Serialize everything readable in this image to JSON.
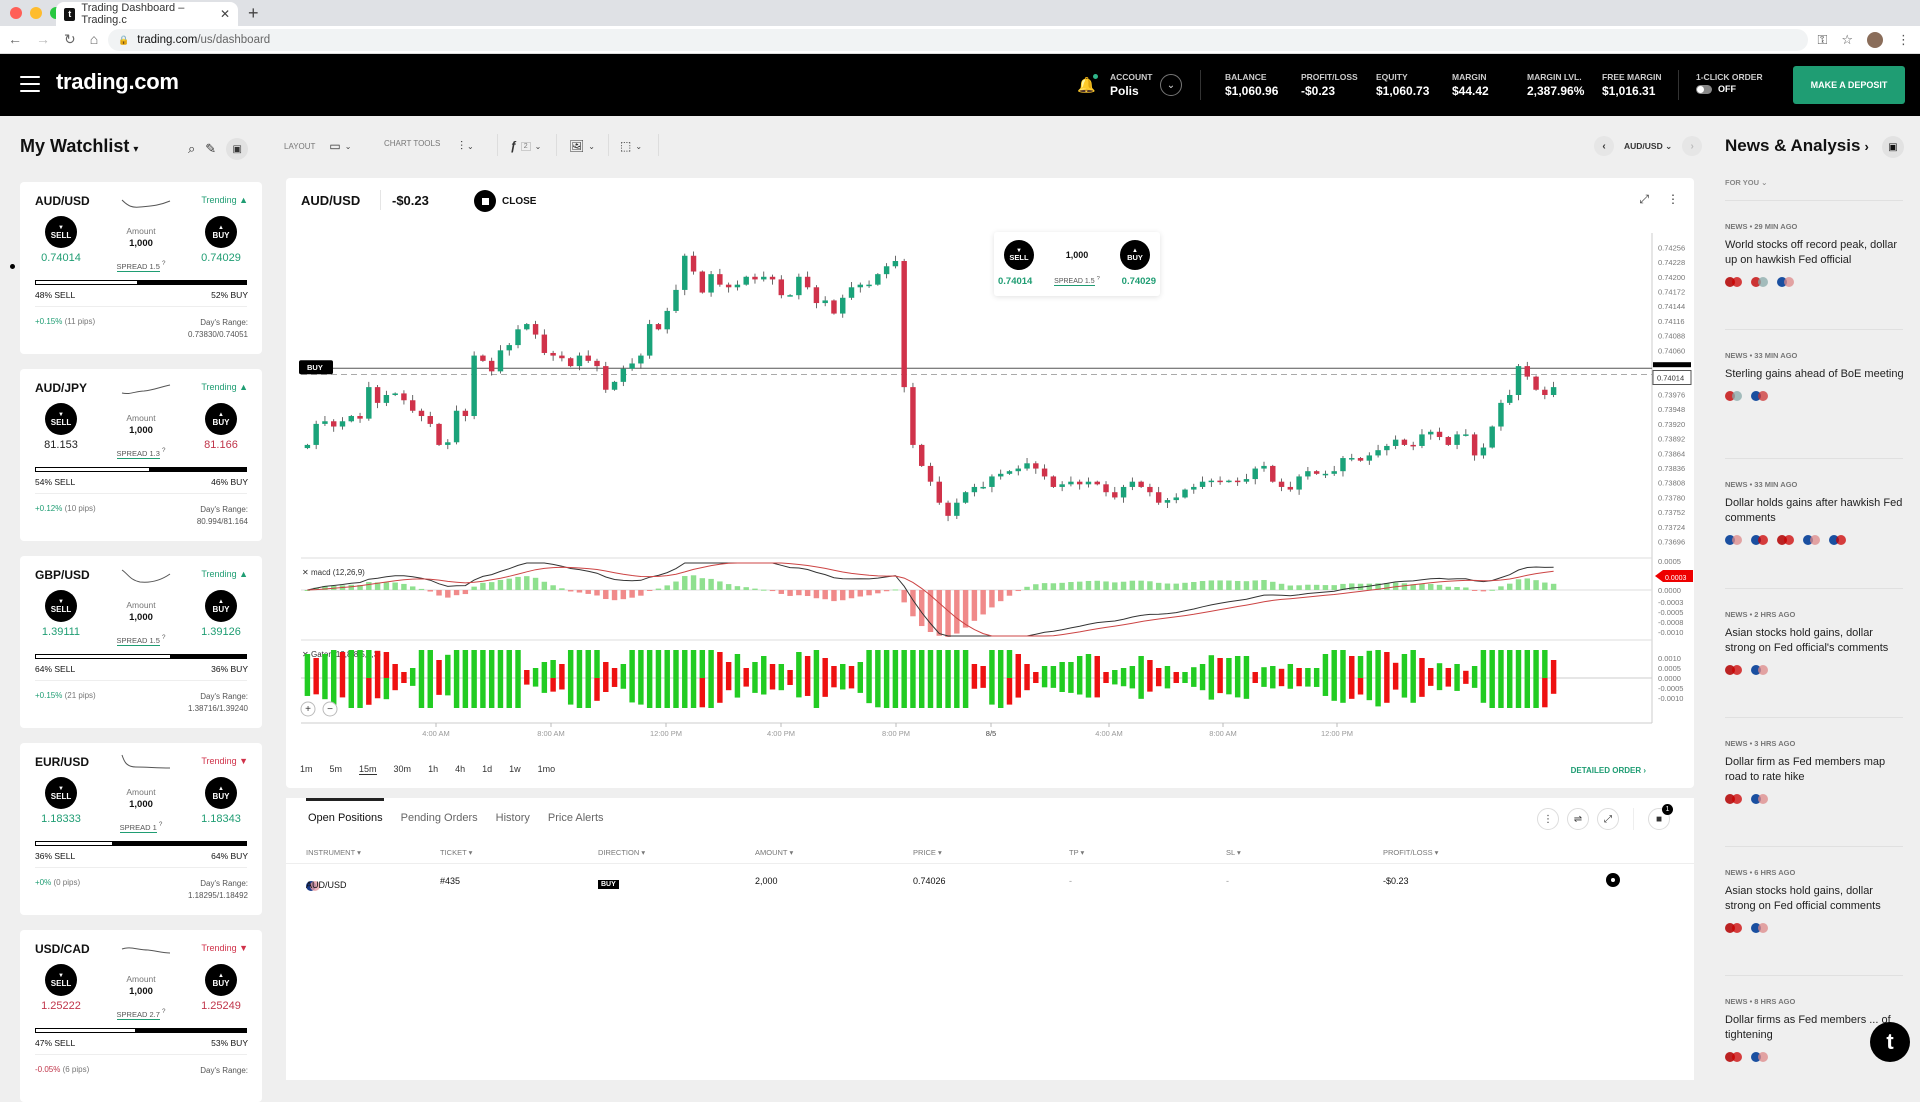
{
  "browser": {
    "tab_title": "Trading Dashboard – Trading.c",
    "url_host": "trading.com",
    "url_path": "/us/dashboard"
  },
  "header": {
    "logo": "trading.com",
    "account_label": "ACCOUNT",
    "account_value": "Polis",
    "stats": [
      {
        "label": "BALANCE",
        "value": "$1,060.96"
      },
      {
        "label": "PROFIT/LOSS",
        "value": "-$0.23"
      },
      {
        "label": "EQUITY",
        "value": "$1,060.73"
      },
      {
        "label": "MARGIN",
        "value": "$44.42"
      },
      {
        "label": "MARGIN LVL.",
        "value": "2,387.96%"
      },
      {
        "label": "FREE MARGIN",
        "value": "$1,016.31"
      }
    ],
    "one_click_label": "1-CLICK ORDER",
    "one_click_state": "OFF",
    "deposit_label": "MAKE A DEPOSIT"
  },
  "watchlist": {
    "title": "My Watchlist",
    "amount_label": "Amount",
    "sell_label": "SELL",
    "buy_label": "BUY",
    "days_range_label": "Day's Range:",
    "items": [
      {
        "symbol": "AUD/USD",
        "trend": "Trending ▲",
        "trend_dir": "up",
        "sell": "0.74014",
        "buy": "0.74029",
        "sell_color": "g",
        "buy_color": "g",
        "amount": "1,000",
        "spread": "SPREAD 1.5",
        "sell_pct": 48,
        "sell_text": "48% SELL",
        "buy_text": "52% BUY",
        "change_pct": "+0.15%",
        "change_color": "g",
        "change_pips": "(11 pips)",
        "range": "0.73830/0.74051"
      },
      {
        "symbol": "AUD/JPY",
        "trend": "Trending ▲",
        "trend_dir": "up",
        "sell": "81.153",
        "buy": "81.166",
        "sell_color": "k",
        "buy_color": "r",
        "amount": "1,000",
        "spread": "SPREAD 1.3",
        "sell_pct": 54,
        "sell_text": "54% SELL",
        "buy_text": "46% BUY",
        "change_pct": "+0.12%",
        "change_color": "g",
        "change_pips": "(10 pips)",
        "range": "80.994/81.164"
      },
      {
        "symbol": "GBP/USD",
        "trend": "Trending ▲",
        "trend_dir": "up",
        "sell": "1.39111",
        "buy": "1.39126",
        "sell_color": "g",
        "buy_color": "g",
        "amount": "1,000",
        "spread": "SPREAD 1.5",
        "sell_pct": 64,
        "sell_text": "64% SELL",
        "buy_text": "36% BUY",
        "change_pct": "+0.15%",
        "change_color": "g",
        "change_pips": "(21 pips)",
        "range": "1.38716/1.39240"
      },
      {
        "symbol": "EUR/USD",
        "trend": "Trending ▼",
        "trend_dir": "down",
        "sell": "1.18333",
        "buy": "1.18343",
        "sell_color": "g",
        "buy_color": "g",
        "amount": "1,000",
        "spread": "SPREAD 1",
        "sell_pct": 36,
        "sell_text": "36% SELL",
        "buy_text": "64% BUY",
        "change_pct": "+0%",
        "change_color": "g",
        "change_pips": "(0 pips)",
        "range": "1.18295/1.18492"
      },
      {
        "symbol": "USD/CAD",
        "trend": "Trending ▼",
        "trend_dir": "down",
        "sell": "1.25222",
        "buy": "1.25249",
        "sell_color": "r",
        "buy_color": "r",
        "amount": "1,000",
        "spread": "SPREAD 2.7",
        "sell_pct": 47,
        "sell_text": "47% SELL",
        "buy_text": "53% BUY",
        "change_pct": "-0.05%",
        "change_color": "r",
        "change_pips": "(6 pips)",
        "range": ""
      }
    ]
  },
  "toolbar": {
    "layout_label": "LAYOUT",
    "chart_tools_label": "CHART TOOLS",
    "indicator_count": "2",
    "pair_selector": "AUD/USD"
  },
  "chart_panel": {
    "symbol": "AUD/USD",
    "pl": "-$0.23",
    "close_label": "CLOSE",
    "quick_trade": {
      "sell_label": "SELL",
      "buy_label": "BUY",
      "amount": "1,000",
      "spread": "SPREAD 1.5",
      "sell_price": "0.74014",
      "buy_price": "0.74029"
    },
    "timeframes": [
      "1m",
      "5m",
      "15m",
      "30m",
      "1h",
      "4h",
      "1d",
      "1w",
      "1mo"
    ],
    "active_timeframe": "15m",
    "detailed_order": "DETAILED ORDER ›",
    "zoom_in": "+",
    "zoom_out": "−"
  },
  "chart_data": {
    "type": "candlestick",
    "title": "AUD/USD",
    "price_axis_ticks": [
      "0.74256",
      "0.74228",
      "0.74200",
      "0.74172",
      "0.74144",
      "0.74116",
      "0.74088",
      "0.74060",
      "0.73976",
      "0.73948",
      "0.73920",
      "0.73892",
      "0.73864",
      "0.73836",
      "0.73808",
      "0.73780",
      "0.73752",
      "0.73724",
      "0.73696"
    ],
    "ylim": [
      0.7368,
      0.7427
    ],
    "current_price_label": "0.74014",
    "buy_line_label": "BUY",
    "buy_line_price": 0.74026,
    "current_price": 0.74014,
    "time_axis_ticks": [
      "4:00 AM",
      "8:00 AM",
      "12:00 PM",
      "4:00 PM",
      "8:00 PM",
      "8/5",
      "4:00 AM",
      "8:00 AM",
      "12:00 PM"
    ],
    "candles_close": [
      0.7388,
      0.7392,
      0.73925,
      0.73915,
      0.73925,
      0.73935,
      0.7393,
      0.7399,
      0.7396,
      0.73975,
      0.73978,
      0.73965,
      0.73945,
      0.73935,
      0.7392,
      0.7388,
      0.73885,
      0.73945,
      0.73935,
      0.7405,
      0.7404,
      0.7402,
      0.7406,
      0.7407,
      0.741,
      0.7411,
      0.7409,
      0.74055,
      0.7405,
      0.74045,
      0.7403,
      0.7405,
      0.7404,
      0.7403,
      0.73985,
      0.74,
      0.74025,
      0.74035,
      0.7405,
      0.7411,
      0.741,
      0.74135,
      0.74175,
      0.7424,
      0.7421,
      0.7417,
      0.74205,
      0.74185,
      0.7418,
      0.74185,
      0.742,
      0.74195,
      0.742,
      0.74195,
      0.74165,
      0.74165,
      0.742,
      0.7418,
      0.7415,
      0.74155,
      0.7413,
      0.7416,
      0.7418,
      0.74185,
      0.74185,
      0.74205,
      0.7422,
      0.7423,
      0.7399,
      0.7388,
      0.7384,
      0.7381,
      0.7377,
      0.73745,
      0.7377,
      0.7379,
      0.738,
      0.738,
      0.7382,
      0.73825,
      0.7383,
      0.73835,
      0.73845,
      0.73835,
      0.7382,
      0.738,
      0.73805,
      0.7381,
      0.73805,
      0.7381,
      0.73805,
      0.7379,
      0.7378,
      0.738,
      0.7381,
      0.738,
      0.7379,
      0.7377,
      0.73775,
      0.7378,
      0.73795,
      0.738,
      0.7381,
      0.73812,
      0.7381,
      0.73812,
      0.7381,
      0.73815,
      0.73835,
      0.7384,
      0.7381,
      0.738,
      0.73795,
      0.7382,
      0.7383,
      0.73825,
      0.73825,
      0.7383,
      0.73855,
      0.73855,
      0.7385,
      0.7386,
      0.7387,
      0.73878,
      0.7389,
      0.7388,
      0.73878,
      0.739,
      0.73905,
      0.73895,
      0.7388,
      0.739,
      0.739,
      0.7386,
      0.73875,
      0.73915,
      0.7396,
      0.73975,
      0.7403,
      0.7401,
      0.73985,
      0.73975,
      0.7399
    ],
    "indicators": [
      {
        "name": "macd (12,26,9)",
        "axis_ticks": [
          "0.0005",
          "0.0000",
          "-0.0003",
          "-0.0005",
          "-0.0008",
          "-0.0010"
        ],
        "current_label": "0.0003"
      },
      {
        "name": "Gator (13,8,8,5,5,3)",
        "axis_ticks": [
          "0.0010",
          "0.0005",
          "0.0000",
          "-0.0005",
          "-0.0010"
        ]
      }
    ]
  },
  "positions": {
    "tabs": [
      "Open Positions",
      "Pending Orders",
      "History",
      "Price Alerts"
    ],
    "active_tab": "Open Positions",
    "badge_count": "1",
    "columns": [
      "INSTRUMENT ▾",
      "TICKET ▾",
      "DIRECTION ▾",
      "AMOUNT ▾",
      "PRICE ▾",
      "TP ▾",
      "SL ▾",
      "PROFIT/LOSS ▾"
    ],
    "rows": [
      {
        "instrument": "AUD/USD",
        "ticket": "#435",
        "direction": "BUY",
        "amount": "2,000",
        "price": "0.74026",
        "tp": "-",
        "sl": "-",
        "pl": "-$0.23"
      }
    ]
  },
  "news": {
    "title": "News & Analysis",
    "filter": "FOR YOU ⌄",
    "items": [
      {
        "meta": "NEWS • 29 MIN AGO",
        "headline": "World stocks off record peak, dollar up on hawkish Fed official",
        "flags": [
          [
            "#b22",
            "#c00"
          ],
          [
            "#c33",
            "#8aa"
          ],
          [
            "#1a4fa0",
            "#d88"
          ]
        ]
      },
      {
        "meta": "NEWS • 33 MIN AGO",
        "headline": "Sterling gains ahead of BoE meeting",
        "flags": [
          [
            "#c33",
            "#8aa"
          ],
          [
            "#1a4fa0",
            "#c33"
          ]
        ]
      },
      {
        "meta": "NEWS • 33 MIN AGO",
        "headline": "Dollar holds gains after hawkish Fed comments",
        "flags": [
          [
            "#1a4fa0",
            "#d88"
          ],
          [
            "#1a4fa0",
            "#c00"
          ],
          [
            "#b22",
            "#c00"
          ],
          [
            "#1a4fa0",
            "#d88"
          ],
          [
            "#1a4fa0",
            "#c00"
          ]
        ]
      },
      {
        "meta": "NEWS • 2 HRS AGO",
        "headline": "Asian stocks hold gains, dollar strong on Fed official's comments",
        "flags": [
          [
            "#b22",
            "#c00"
          ],
          [
            "#1a4fa0",
            "#d88"
          ]
        ]
      },
      {
        "meta": "NEWS • 3 HRS AGO",
        "headline": "Dollar firm as Fed members map road to rate hike",
        "flags": [
          [
            "#b22",
            "#c00"
          ],
          [
            "#1a4fa0",
            "#d88"
          ]
        ]
      },
      {
        "meta": "NEWS • 6 HRS AGO",
        "headline": "Asian stocks hold gains, dollar strong on Fed official comments",
        "flags": [
          [
            "#b22",
            "#c00"
          ],
          [
            "#1a4fa0",
            "#d88"
          ]
        ]
      },
      {
        "meta": "NEWS • 8 HRS AGO",
        "headline": "Dollar firms as Fed members ... of tightening",
        "flags": [
          [
            "#b22",
            "#c00"
          ],
          [
            "#1a4fa0",
            "#d88"
          ]
        ]
      }
    ]
  },
  "colors": {
    "accent": "#1f9d73",
    "up": "#1aa37a",
    "down": "#d0324a",
    "gator_up": "#22cc22",
    "gator_down": "#ee1111"
  }
}
